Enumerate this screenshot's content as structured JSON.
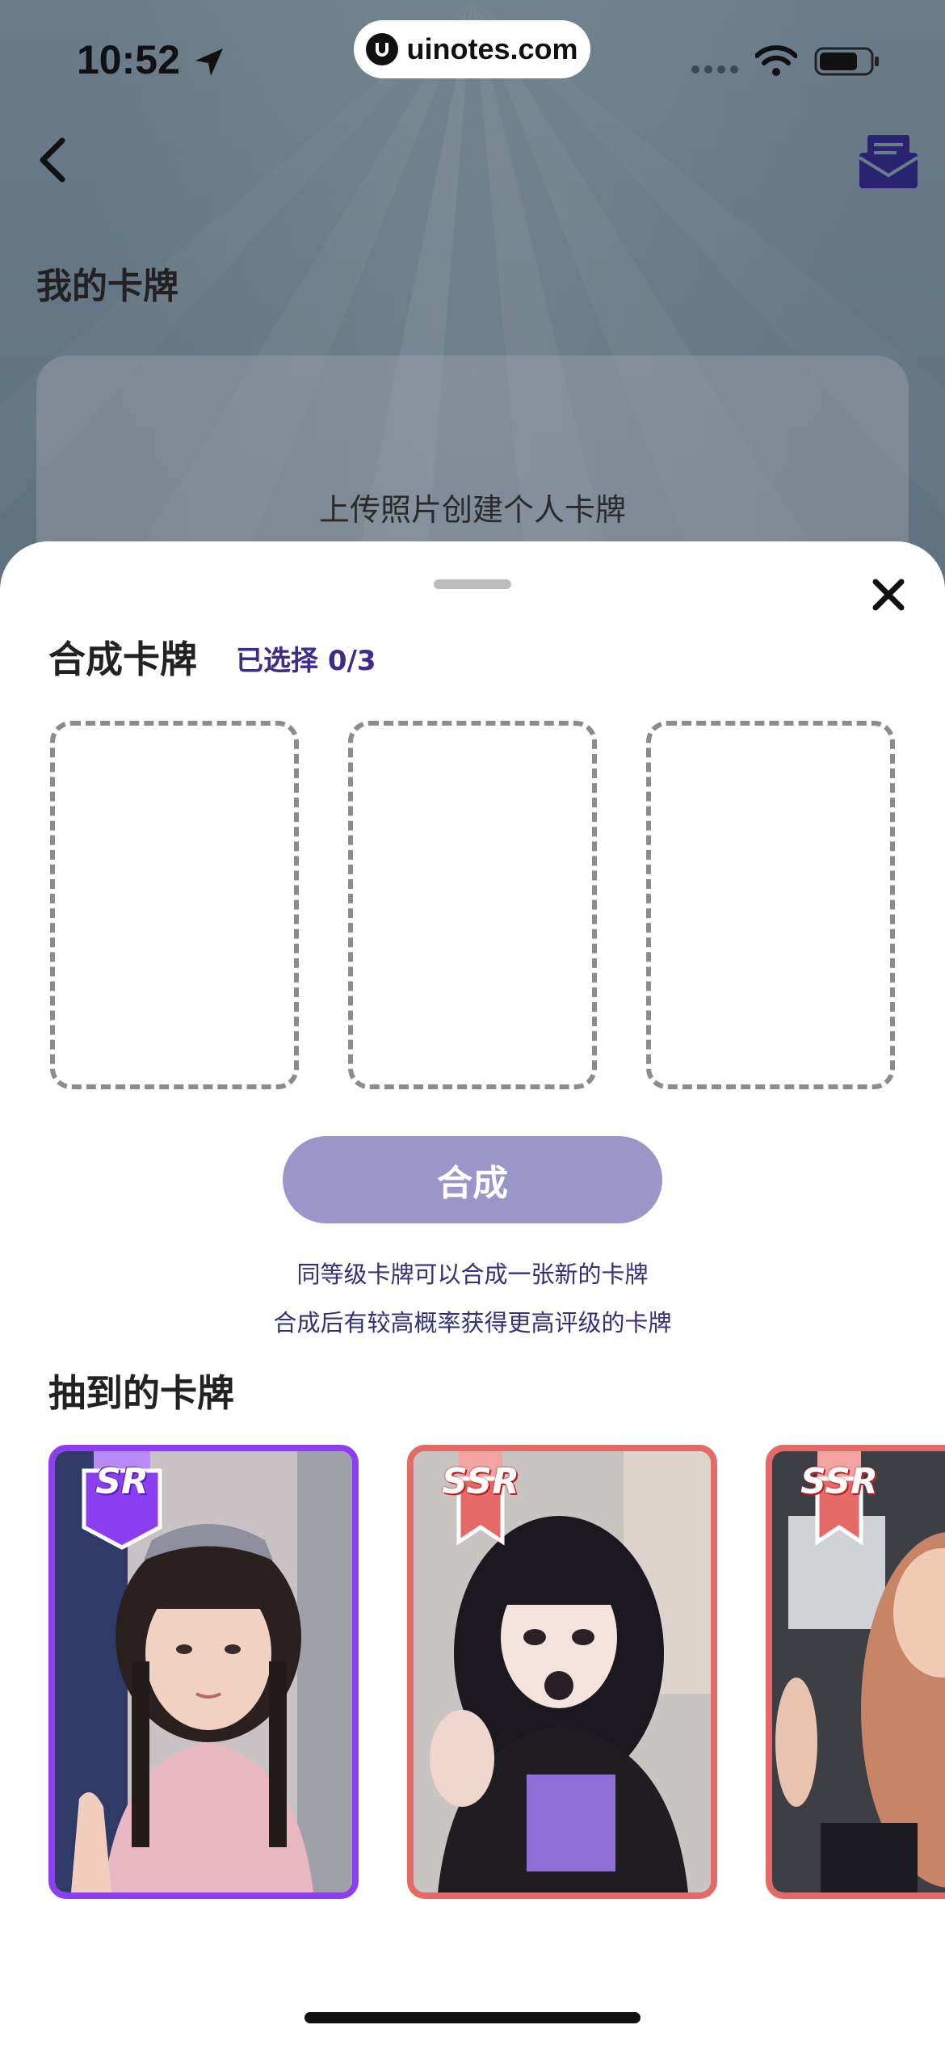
{
  "status_bar": {
    "time": "10:52",
    "url": "uinotes.com"
  },
  "nav": {
    "back_icon": "chevron-left-icon",
    "mail_icon": "mail-open-icon"
  },
  "background_page": {
    "title": "我的卡牌",
    "upload_text": "上传照片创建个人卡牌"
  },
  "sheet": {
    "title": "合成卡牌",
    "selected_label": "已选择 0/3",
    "merge_button": "合成",
    "hint_line_1": "同等级卡牌可以合成一张新的卡牌",
    "hint_line_2": "合成后有较高概率获得更高评级的卡牌",
    "drawn_title": "抽到的卡牌",
    "cards": [
      {
        "rarity": "SR",
        "color": "#8b3ff0"
      },
      {
        "rarity": "SSR",
        "color": "#e36a66"
      },
      {
        "rarity": "SSR",
        "color": "#e36a66"
      }
    ]
  },
  "colors": {
    "accent": "#3b2d8a",
    "button": "#9c95c9",
    "sr": "#8b3ff0",
    "ssr": "#e36a66"
  }
}
